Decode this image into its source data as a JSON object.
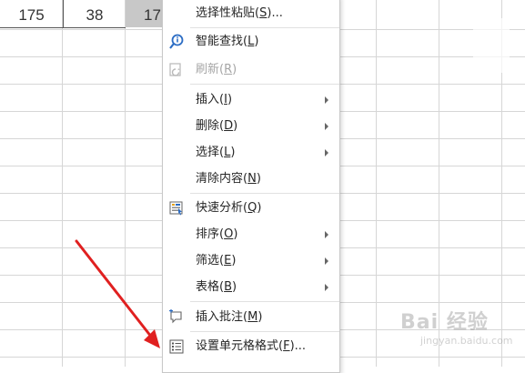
{
  "sheet": {
    "cells": [
      "175",
      "38",
      "17"
    ]
  },
  "context_menu": {
    "items": [
      {
        "label": "选择性粘贴",
        "accel": "S",
        "suffix": "..."
      },
      {
        "label": "智能查找",
        "accel": "L",
        "suffix": ""
      },
      {
        "label": "刷新",
        "accel": "R",
        "suffix": ""
      },
      {
        "label": "插入",
        "accel": "I",
        "suffix": ""
      },
      {
        "label": "删除",
        "accel": "D",
        "suffix": ""
      },
      {
        "label": "选择",
        "accel": "L",
        "suffix": ""
      },
      {
        "label": "清除内容",
        "accel": "N",
        "suffix": ""
      },
      {
        "label": "快速分析",
        "accel": "Q",
        "suffix": ""
      },
      {
        "label": "排序",
        "accel": "O",
        "suffix": ""
      },
      {
        "label": "筛选",
        "accel": "E",
        "suffix": ""
      },
      {
        "label": "表格",
        "accel": "B",
        "suffix": ""
      },
      {
        "label": "插入批注",
        "accel": "M",
        "suffix": ""
      },
      {
        "label": "设置单元格格式",
        "accel": "F",
        "suffix": "..."
      }
    ]
  },
  "annotation": {
    "arrow_color": "#e02020"
  },
  "watermark": {
    "text": "Bai 经验",
    "sub": "jingyan.baidu.com"
  }
}
